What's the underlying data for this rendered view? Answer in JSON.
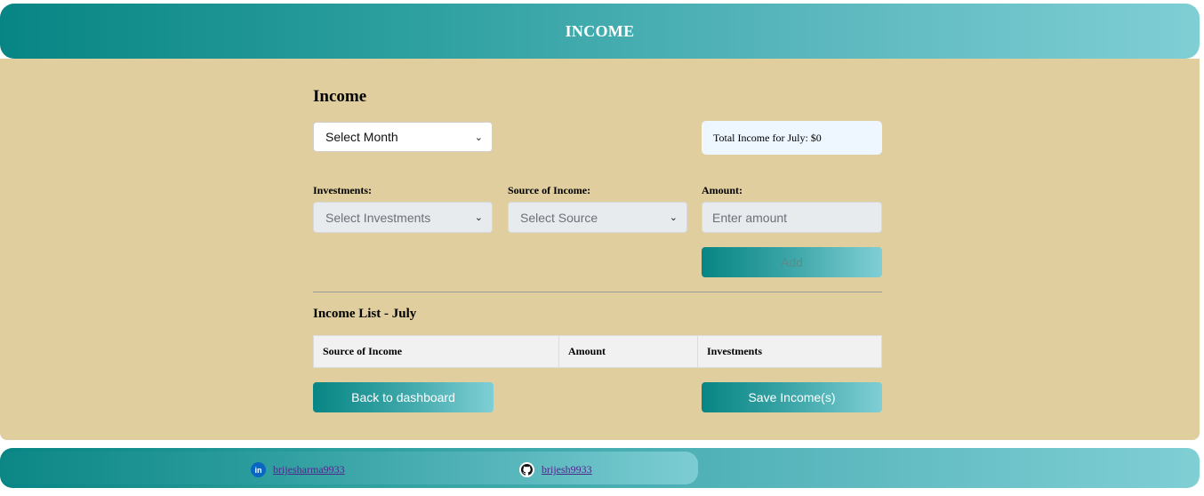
{
  "header": {
    "title": "INCOME"
  },
  "form": {
    "heading": "Income",
    "month_select": {
      "value": "Select Month"
    },
    "total_income_text": "Total Income for July: $0",
    "investments": {
      "label": "Investments:",
      "value": "Select Investments"
    },
    "source": {
      "label": "Source of Income:",
      "value": "Select Source"
    },
    "amount": {
      "label": "Amount:",
      "placeholder": "Enter amount"
    },
    "add_label": "Add"
  },
  "income_list": {
    "title": "Income List - July",
    "columns": [
      "Source of Income",
      "Amount",
      "Investments"
    ]
  },
  "actions": {
    "back_label": "Back to dashboard",
    "save_label": "Save Income(s)"
  },
  "footer": {
    "linkedin_username": "brijesharma9933",
    "github_username": "brijesh9933",
    "linkedin_icon_text": "in"
  },
  "colors": {
    "accent_start": "#078584",
    "accent_end": "#7fcfd5",
    "panel_background": "#e0ce9e"
  },
  "icons": {
    "linkedin": "linkedin-icon",
    "github": "github-icon",
    "chevron": "chevron-down-icon"
  }
}
